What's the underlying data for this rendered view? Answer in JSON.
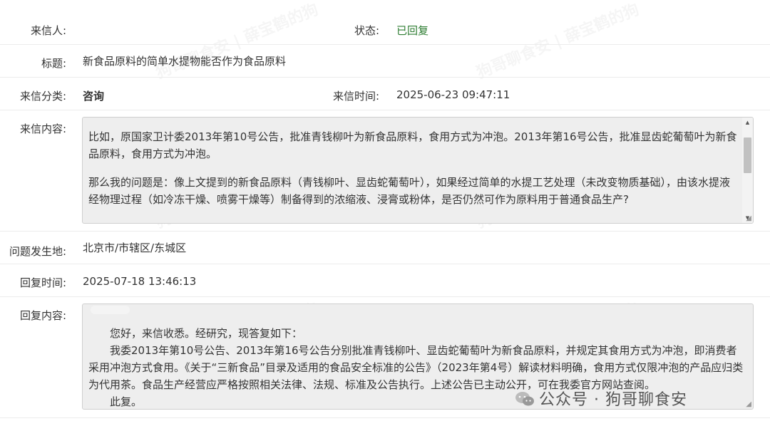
{
  "letter": {
    "sender_label": "来信人:",
    "sender_value": "",
    "status_label": "状态:",
    "status_value": "已回复",
    "title_label": "标题:",
    "title_value": "新食品原料的简单水提物能否作为食品原料",
    "category_label": "来信分类:",
    "category_value": "咨询",
    "time_label": "来信时间:",
    "time_value": "2025-06-23 09:47:11",
    "content_label": "来信内容:",
    "content_p1": "比如，原国家卫计委2013年第10号公告，批准青钱柳叶为新食品原料，食用方式为冲泡。2013年第16号公告，批准显齿蛇葡萄叶为新食品原料，食用方式为冲泡。",
    "content_p2": "那么我的问题是：像上文提到的新食品原料（青钱柳叶、显齿蛇葡萄叶），如果经过简单的水提工艺处理（未改变物质基础），由该水提液经物理过程（如冷冻干燥、喷雾干燥等）制备得到的浓缩液、浸膏或粉体，是否仍然可作为原料用于普通食品生产?",
    "location_label": "问题发生地:",
    "location_value": "北京市/市辖区/东城区"
  },
  "reply": {
    "time_label": "回复时间:",
    "time_value": "2025-07-18 13:46:13",
    "content_label": "回复内容:",
    "line1": "您好，来信收悉。经研究，现答复如下：",
    "line2": "我委2013年第10号公告、2013年第16号公告分别批准青钱柳叶、显齿蛇葡萄叶为新食品原料，并规定其食用方式为冲泡，即消费者采用冲泡方式食用。《关于“三新食品”目录及适用的食品安全标准的公告》（2023年第4号）解读材料明确，食用方式仅限冲泡的产品应归类为代用茶。食品生产经营应严格按照相关法律、法规、标准及公告执行。上述公告已主动公开，可在我委官方网站查阅。",
    "line3": "此复。"
  },
  "overlay": {
    "brand": "公众号 · 狗哥聊食安",
    "watermark": "狗哥聊食安 | 薛宝鹤的狗"
  },
  "colors": {
    "status": "#2e7d32",
    "box_bg": "#eeeeee"
  }
}
